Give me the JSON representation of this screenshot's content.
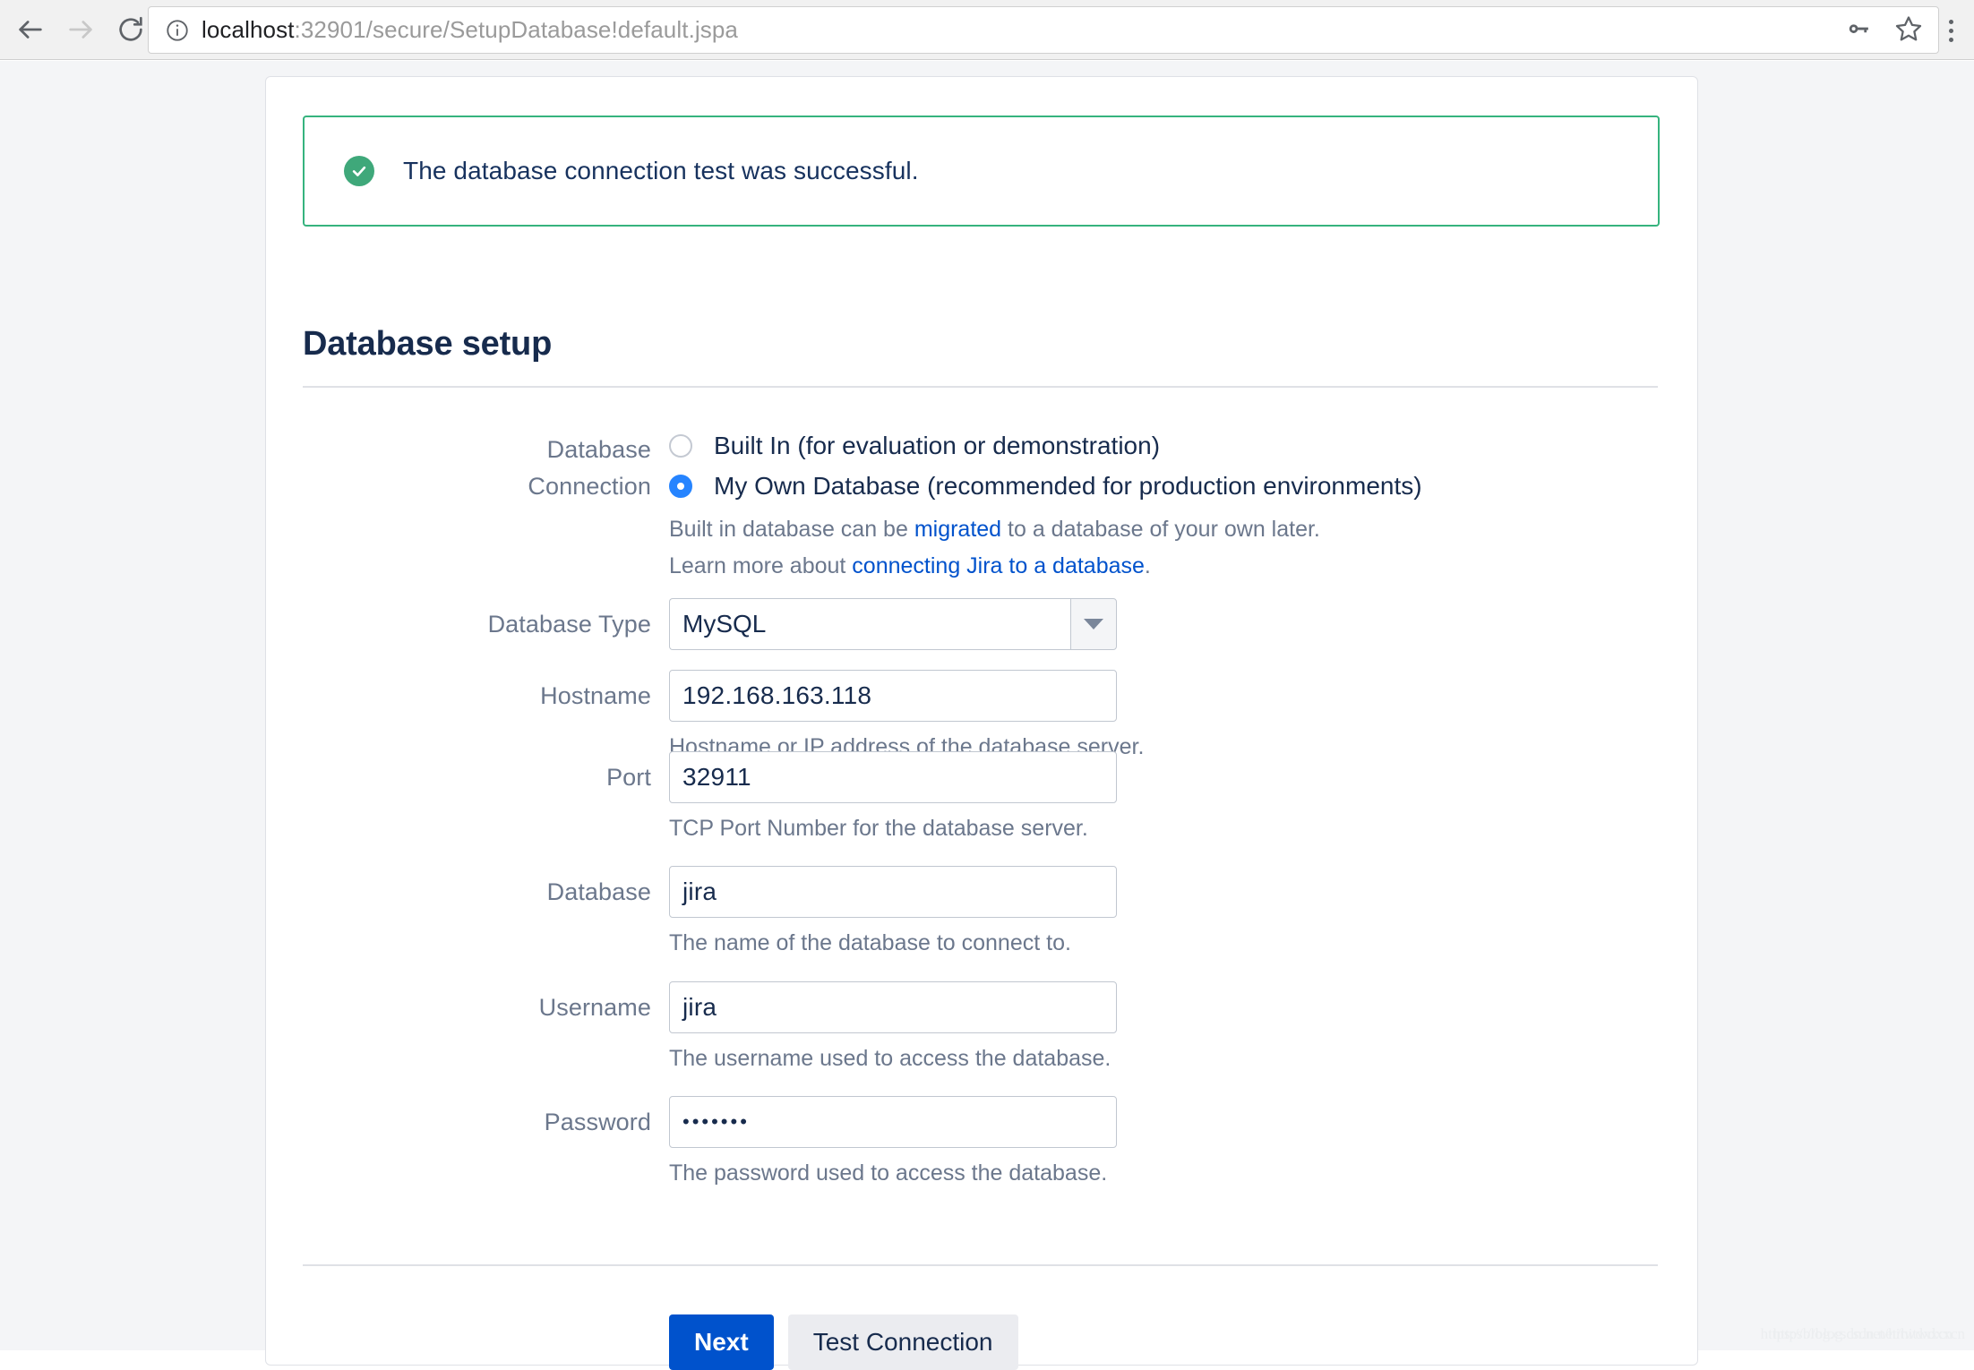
{
  "browser": {
    "back_icon": "back-arrow-icon",
    "forward_icon": "forward-arrow-icon",
    "reload_icon": "reload-icon",
    "info_icon": "info-circle-icon",
    "url_host": "localhost",
    "url_path": ":32901/secure/SetupDatabase!default.jspa",
    "url_full": "localhost:32901/secure/SetupDatabase!default.jspa",
    "key_icon": "key-icon",
    "star_icon": "star-bookmark-icon",
    "menu_icon": "kebab-menu-icon"
  },
  "banner": {
    "icon": "check-circle-icon",
    "message": "The database connection test was successful.",
    "border_color": "#36b37e",
    "icon_color": "#3fa87a"
  },
  "page": {
    "heading": "Database setup"
  },
  "form": {
    "connection": {
      "label_line1": "Database",
      "label_line2": "Connection",
      "options": [
        {
          "label": "Built In (for evaluation or demonstration)",
          "selected": false
        },
        {
          "label": "My Own Database (recommended for production environments)",
          "selected": true
        }
      ],
      "desc1_pre": "Built in database can be ",
      "desc1_link": "migrated",
      "desc1_post": " to a database of your own later.",
      "desc2_pre": "Learn more about ",
      "desc2_link": "connecting Jira to a database",
      "desc2_post": "."
    },
    "fields": [
      {
        "label": "Database Type",
        "type": "select",
        "value": "MySQL",
        "caret_icon": "chevron-down-icon",
        "help": ""
      },
      {
        "label": "Hostname",
        "type": "text",
        "value": "192.168.163.118",
        "help": "Hostname or IP address of the database server."
      },
      {
        "label": "Port",
        "type": "text",
        "value": "32911",
        "help": "TCP Port Number for the database server."
      },
      {
        "label": "Database",
        "type": "text",
        "value": "jira",
        "help": "The name of the database to connect to."
      },
      {
        "label": "Username",
        "type": "text",
        "value": "jira",
        "help": "The username used to access the database."
      },
      {
        "label": "Password",
        "type": "password",
        "value": "•••••••",
        "help": "The password used to access the database."
      }
    ],
    "buttons": {
      "primary": "Next",
      "secondary": "Test Connection",
      "primary_color": "#0052cc"
    }
  },
  "watermark": {
    "text1": "https://blog.csdn.net/hitwdxxcn",
    "text2": "https://blog.csdn.net/hitwdxxcn"
  }
}
